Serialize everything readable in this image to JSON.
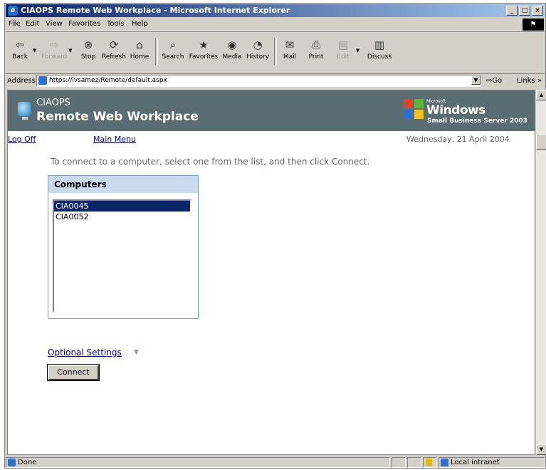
{
  "window": {
    "title": "CIAOPS Remote Web Workplace - Microsoft Internet Explorer"
  },
  "menubar": {
    "items": [
      "File",
      "Edit",
      "View",
      "Favorites",
      "Tools",
      "Help"
    ]
  },
  "toolbar": {
    "back": "Back",
    "forward": "Forward",
    "stop": "Stop",
    "refresh": "Refresh",
    "home": "Home",
    "search": "Search",
    "favorites": "Favorites",
    "media": "Media",
    "history": "History",
    "mail": "Mail",
    "print": "Print",
    "edit": "Edit",
    "discuss": "Discuss"
  },
  "address": {
    "label": "Address",
    "url": "https://lvsamez/Remote/default.aspx",
    "go": "Go",
    "links": "Links »"
  },
  "header": {
    "subtitle": "CIAOPS",
    "title": "Remote Web Workplace",
    "windows_micro": "Microsoft",
    "windows_word": "Windows",
    "sbs": "Small Business Server 2003"
  },
  "nav": {
    "logoff": "Log Off",
    "main_menu": "Main Menu",
    "date": "Wednesday, 21 April 2004"
  },
  "content": {
    "instruction": "To connect to a computer, select one from the list, and then click Connect.",
    "computers_title": "Computers",
    "computers": [
      "CIA0045",
      "CIA0052"
    ],
    "selected_index": 0,
    "optional_settings": "Optional Settings",
    "connect_label": "Connect"
  },
  "status": {
    "text": "Done",
    "zone": "Local intranet"
  },
  "colors": {
    "title_bar": "#0a246a",
    "header_bg": "#5a6d72",
    "selection": "#0a246a",
    "link": "#00009c",
    "panel_head": "#c9dcef"
  }
}
